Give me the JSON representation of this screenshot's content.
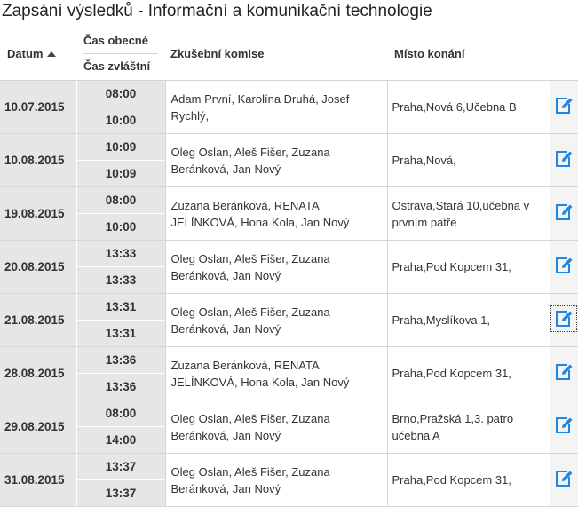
{
  "page": {
    "title": "Zapsání výsledků - Informační a komunikační technologie"
  },
  "header": {
    "date": "Datum",
    "time_general": "Čas obecné",
    "time_special": "Čas zvláštní",
    "committee": "Zkušební komise",
    "place": "Místo konání"
  },
  "colors": {
    "accent": "#1e88e5",
    "date_bg": "#e6e6e8"
  },
  "icons": {
    "edit": "edit-icon",
    "sort": "sort-ascending-icon"
  },
  "rows": [
    {
      "date": "10.07.2015",
      "time1": "08:00",
      "time2": "10:00",
      "committee": "Adam První, Karolína Druhá, Josef Rychlý,",
      "place": "Praha,Nová 6,Učebna B"
    },
    {
      "date": "10.08.2015",
      "time1": "10:09",
      "time2": "10:09",
      "committee": "Oleg Oslan, Aleš Fišer, Zuzana Beránková, Jan Nový",
      "place": "Praha,Nová,"
    },
    {
      "date": "19.08.2015",
      "time1": "08:00",
      "time2": "10:00",
      "committee": "Zuzana Beránková, RENATA JELÍNKOVÁ, Hona Kola, Jan Nový",
      "place": "Ostrava,Stará 10,učebna v prvním patře"
    },
    {
      "date": "20.08.2015",
      "time1": "13:33",
      "time2": "13:33",
      "committee": "Oleg Oslan, Aleš Fišer, Zuzana Beránková, Jan Nový",
      "place": "Praha,Pod Kopcem 31,"
    },
    {
      "date": "21.08.2015",
      "time1": "13:31",
      "time2": "13:31",
      "committee": "Oleg Oslan, Aleš Fišer, Zuzana Beránková, Jan Nový",
      "place": "Praha,Myslíkova 1,"
    },
    {
      "date": "28.08.2015",
      "time1": "13:36",
      "time2": "13:36",
      "committee": "Zuzana Beránková, RENATA JELÍNKOVÁ, Hona Kola, Jan Nový",
      "place": "Praha,Pod Kopcem 31,"
    },
    {
      "date": "29.08.2015",
      "time1": "08:00",
      "time2": "14:00",
      "committee": "Oleg Oslan, Aleš Fišer, Zuzana Beránková, Jan Nový",
      "place": "Brno,Pražská 1,3. patro učebna A"
    },
    {
      "date": "31.08.2015",
      "time1": "13:37",
      "time2": "13:37",
      "committee": "Oleg Oslan, Aleš Fišer, Zuzana Beránková, Jan Nový",
      "place": "Praha,Pod Kopcem 31,"
    }
  ]
}
